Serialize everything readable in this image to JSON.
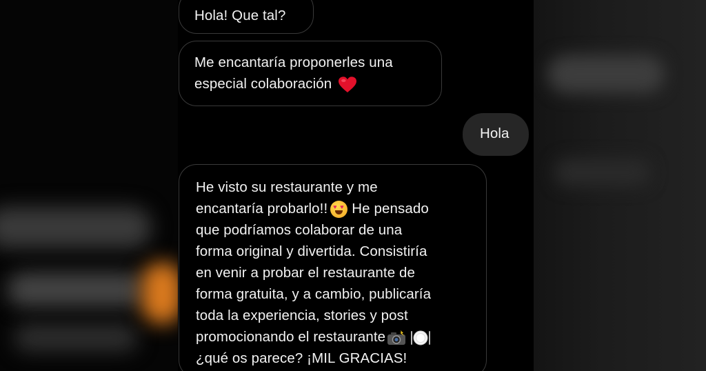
{
  "messages": [
    {
      "from": "them",
      "lines": [
        "Hola! Que tal?"
      ]
    },
    {
      "from": "them",
      "lines": [
        "Me encantaría proponerles una",
        "especial colaboración"
      ],
      "emoji": "red-heart"
    },
    {
      "from": "me",
      "lines": [
        "Hola"
      ]
    },
    {
      "from": "them",
      "lines": [
        "He visto su restaurante y me",
        "encantaría probarlo!!",
        "He pensado",
        "que podríamos colaborar de una",
        "forma original y divertida. Consistiría",
        "en venir a probar el restaurante de",
        "forma gratuita, y a cambio, publicaría",
        "toda la experiencia, stories y post",
        "promocionando el restaurante",
        "¿qué os parece? ¡MIL GRACIAS!"
      ],
      "emojis": [
        "heart-eyes-face",
        "camera-with-flash",
        "fork-knife-plate"
      ]
    }
  ],
  "colors": {
    "background": "#000000",
    "incoming_border": "#3a3a3a",
    "outgoing_bubble": "#262626",
    "text": "#f2f2f2"
  }
}
